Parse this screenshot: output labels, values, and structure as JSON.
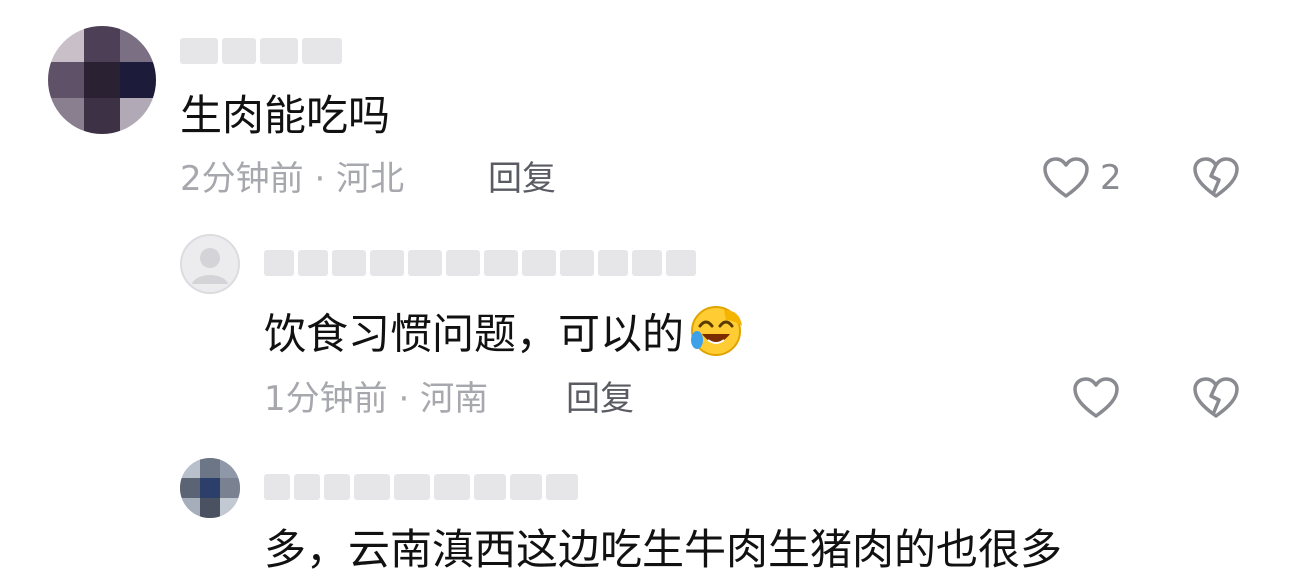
{
  "comments": [
    {
      "text": "生肉能吃吗",
      "time": "2分钟前",
      "separator": " · ",
      "location": "河北",
      "reply_label": "回复",
      "likes": "2"
    },
    {
      "text": "饮食习惯问题，可以的",
      "emoji": "laughing-with-tears-emoji",
      "time": "1分钟前",
      "separator": " · ",
      "location": "河南",
      "reply_label": "回复",
      "likes": ""
    },
    {
      "text": "多，云南滇西这边吃生牛肉生猪肉的也很多"
    }
  ],
  "colors": {
    "meta_text": "#a7a8ad",
    "reply_text": "#5a5b63",
    "icon_stroke": "#8a8b91",
    "blur_gray": "#e6e6e9"
  }
}
